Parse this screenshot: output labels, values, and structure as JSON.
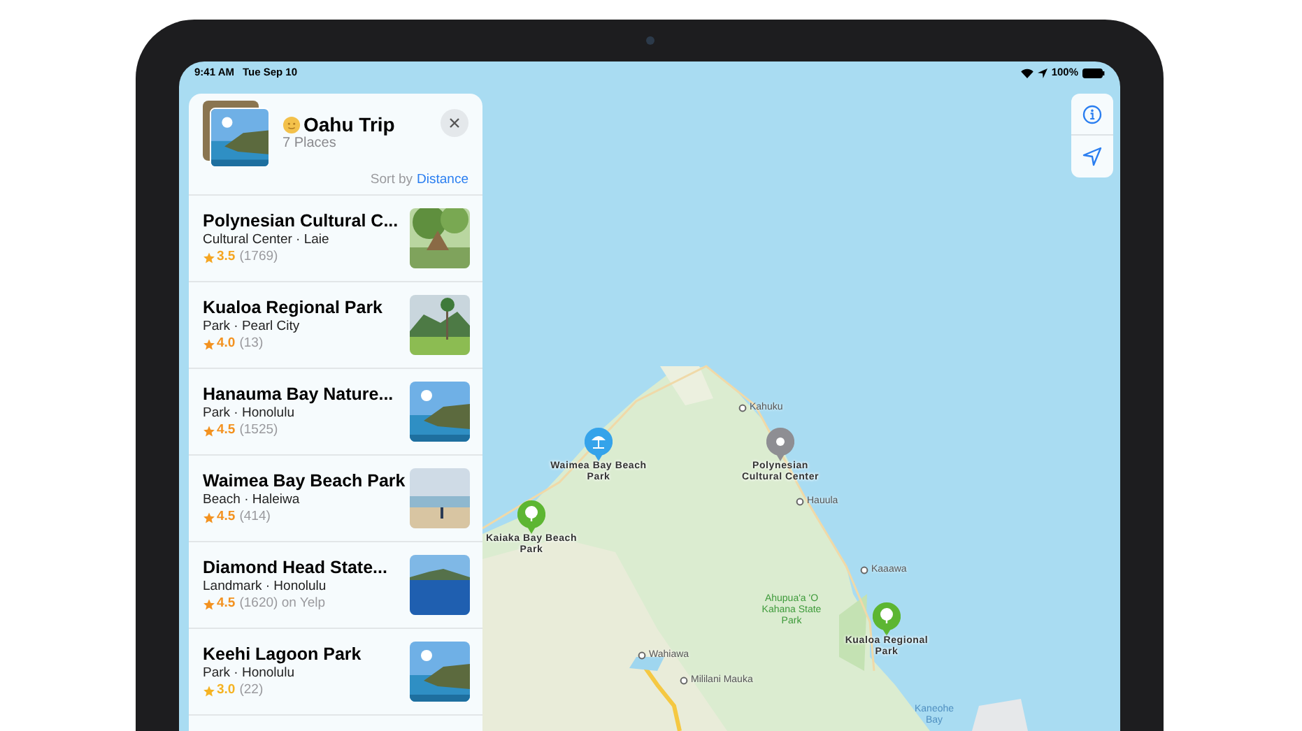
{
  "status_bar": {
    "time": "9:41 AM",
    "date": "Tue Sep 10",
    "battery": "100%"
  },
  "guide": {
    "title": "Oahu Trip",
    "count": "7 Places",
    "sort_label": "Sort by",
    "sort_value": "Distance"
  },
  "places": [
    {
      "name": "Polynesian Cultural C...",
      "category": "Cultural Center · Laie",
      "rating": "3.5",
      "reviews": "(1769)",
      "color": "#f5a623"
    },
    {
      "name": "Kualoa Regional Park",
      "category": "Park · Pearl City",
      "rating": "4.0",
      "reviews": "(13)",
      "color": "#f39220"
    },
    {
      "name": "Hanauma Bay Nature...",
      "category": "Park · Honolulu",
      "rating": "4.5",
      "reviews": "(1525)",
      "color": "#f39220"
    },
    {
      "name": "Waimea Bay Beach Park",
      "category": "Beach · Haleiwa",
      "rating": "4.5",
      "reviews": "(414)",
      "color": "#f39220"
    },
    {
      "name": "Diamond Head State...",
      "category": "Landmark · Honolulu",
      "rating": "4.5",
      "reviews": "(1620) on Yelp",
      "color": "#f39220"
    },
    {
      "name": "Keehi Lagoon Park",
      "category": "Park · Honolulu",
      "rating": "3.0",
      "reviews": "(22)",
      "color": "#f5b323"
    }
  ],
  "pins": [
    {
      "kind": "beach",
      "label": "Waimea Bay Beach Park"
    },
    {
      "kind": "landmark",
      "label": "Polynesian Cultural Center"
    },
    {
      "kind": "park",
      "label": "Kaiaka Bay Beach Park"
    },
    {
      "kind": "park",
      "label": "Kualoa Regional Park"
    }
  ],
  "map_labels": [
    {
      "kind": "town",
      "text": "Kahuku"
    },
    {
      "kind": "town",
      "text": "Hauula"
    },
    {
      "kind": "town",
      "text": "Kaaawa"
    },
    {
      "kind": "park",
      "text": "Ahupua'a 'O Kahana State Park"
    },
    {
      "kind": "town",
      "text": "Wahiawa"
    },
    {
      "kind": "town",
      "text": "Mililani Mauka"
    },
    {
      "kind": "water",
      "text": "Kaneohe Bay"
    }
  ]
}
